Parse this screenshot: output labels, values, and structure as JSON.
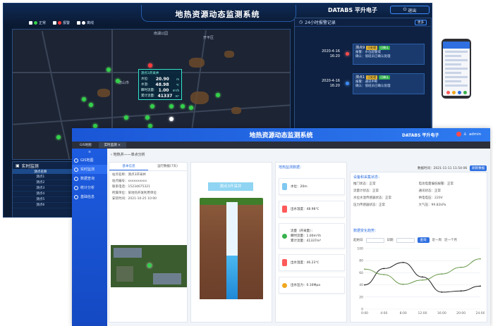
{
  "dashboard": {
    "title": "地热资源动态监测系统",
    "brand": "DATABS 平升电子",
    "exit_label": "退出",
    "legend": [
      {
        "label": "正常",
        "color": "#33d14a"
      },
      {
        "label": "报警",
        "color": "#ff3b3b"
      },
      {
        "label": "离线",
        "color": "#ffffff"
      }
    ],
    "map_labels": [
      "唐山市",
      "开平区",
      "南湖公园"
    ],
    "popup": {
      "title": "测点3开采井",
      "rows": [
        {
          "label": "水位:",
          "value": "20.90",
          "unit": "m"
        },
        {
          "label": "水温:",
          "value": "48.98",
          "unit": "℃"
        },
        {
          "label": "瞬时流量:",
          "value": "1.00",
          "unit": "m³/h"
        },
        {
          "label": "累计流量:",
          "value": "41337",
          "unit": "m³"
        }
      ]
    },
    "realtime": {
      "title": "实时监测",
      "headers": [
        "测点名称",
        "区域"
      ],
      "rows": [
        [
          "测点1",
          "区域"
        ],
        [
          "测点2",
          "区域"
        ],
        [
          "测点3",
          "区域"
        ],
        [
          "测点4",
          "区域"
        ],
        [
          "测点5",
          "区域"
        ],
        [
          "测点6",
          "区域"
        ]
      ]
    },
    "warnings": {
      "title": "24小时报警记录",
      "more": "更多",
      "items": [
        {
          "date": "2020-4-16",
          "time": "16:20",
          "name": "测点9",
          "tag1": "已处理",
          "tag2": "已确认",
          "line1": "报警：水位超警戒",
          "line2": "确认：值班员已确认处理"
        },
        {
          "date": "2020-4-16",
          "time": "16:20",
          "name": "测点1",
          "tag1": "已处理",
          "tag2": "已确认",
          "line1": "报警：通讯中断",
          "line2": "确认：值班员已确认处理"
        }
      ]
    }
  },
  "front": {
    "title": "地热资源动态监测系统",
    "brand": "DATABS 平升电子",
    "user": "admin",
    "tabs": [
      "GIS地图",
      "实时监测 ×"
    ],
    "sidebar": [
      {
        "label": "GIS地图",
        "active": false
      },
      {
        "label": "实时监测",
        "active": true
      },
      {
        "label": "数据查询",
        "active": false
      },
      {
        "label": "统计分析",
        "active": false
      },
      {
        "label": "基础信息",
        "active": false
      }
    ],
    "breadcrumb": "地热井——单点分析",
    "stamp": "数据时间：2021-11-11  11:54:06",
    "stamp_btn": "刷新数据",
    "basic_tabs": [
      "基本信息",
      "运行数据(7天)"
    ],
    "basic_info": [
      "站点名称：测点3开采井",
      "站点编号：xxxxxxxxxx",
      "联系电话：15234675321",
      "所属单位：某地热开发利用单位",
      "安装时间：2021-10-25  10:00"
    ],
    "well_title": "测点3开采井",
    "data_title": "地热监测数据：",
    "data_items": [
      {
        "lines": [
          "水位：20m"
        ],
        "color": "#7fc8f0"
      },
      {
        "lines": [
          "出水温度：48.98℃"
        ],
        "color": "#ff5a5a"
      },
      {
        "lines": [
          "流量（开采量）：",
          "瞬时流量：1.00m³/h",
          "累计流量：41337m³"
        ],
        "color": "#37b24d"
      },
      {
        "lines": [
          "出水温度：46.23℃"
        ],
        "color": "#ff5a5a"
      },
      {
        "lines": [
          "出水压力：0.16Mpa"
        ],
        "color": "#f0a81e"
      }
    ],
    "params_title": "设备和采集状态：",
    "params": [
      "推门状态：正常",
      "电池电量偏低报警：正常",
      "流量计状态：正常",
      "通讯状态：正常",
      "水位水温传感器状态：正常",
      "供电电压：220V",
      "压力传感器状态：正常",
      "大气压：99.82kPa"
    ],
    "trend_title": "数据变化趋势：",
    "trend_tools": {
      "label1": "起始日",
      "label2": "日期",
      "search": "查询",
      "opt1": "近一周",
      "opt2": "近一个月"
    }
  },
  "chart_data": {
    "type": "line",
    "x": [
      "0:00",
      "4:00",
      "8:00",
      "12:00",
      "16:00",
      "20:00",
      "24:00"
    ],
    "ylim": [
      0,
      100
    ],
    "yticks": [
      0,
      20,
      40,
      60,
      80,
      100
    ],
    "series": [
      {
        "name": "",
        "color": "#222222",
        "values": [
          40,
          67,
          77,
          53,
          28,
          30,
          38
        ]
      },
      {
        "name": "",
        "color": "#6a9a4a",
        "values": [
          66,
          57,
          41,
          48,
          58,
          69,
          83
        ]
      }
    ],
    "grid": true
  }
}
